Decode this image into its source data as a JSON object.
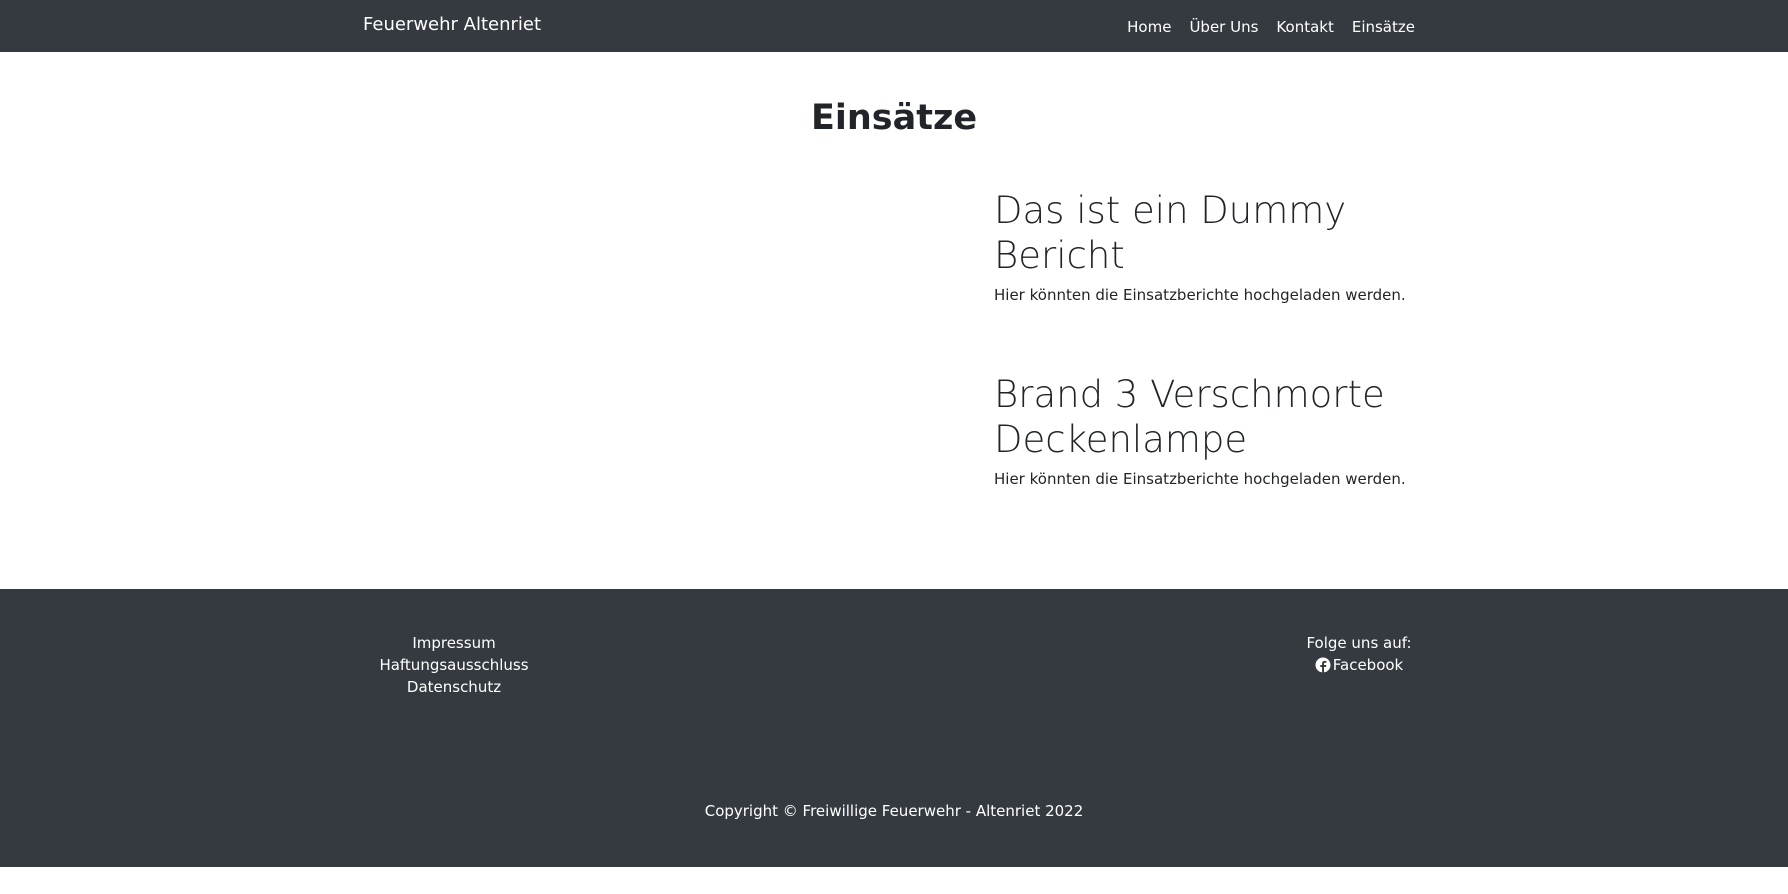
{
  "navbar": {
    "brand": "Feuerwehr Altenriet",
    "items": [
      {
        "label": "Home"
      },
      {
        "label": "Über Uns"
      },
      {
        "label": "Kontakt"
      },
      {
        "label": "Einsätze"
      }
    ]
  },
  "main": {
    "title": "Einsätze",
    "reports": [
      {
        "title": "Das ist ein Dummy Bericht",
        "text": "Hier könnten die Einsatzberichte hochgeladen werden."
      },
      {
        "title": "Brand 3 Verschmorte Deckenlampe",
        "text": "Hier könnten die Einsatzberichte hochgeladen werden."
      }
    ]
  },
  "footer": {
    "links": [
      {
        "label": "Impressum"
      },
      {
        "label": "Haftungsausschluss"
      },
      {
        "label": "Datenschutz"
      }
    ],
    "follow_label": "Folge uns auf:",
    "facebook_label": "Facebook",
    "facebook_icon": "facebook-icon",
    "copyright": "Copyright © Freiwillige Feuerwehr - Altenriet 2022"
  },
  "colors": {
    "dark": "#343a40",
    "text": "#212529",
    "white": "#ffffff"
  }
}
